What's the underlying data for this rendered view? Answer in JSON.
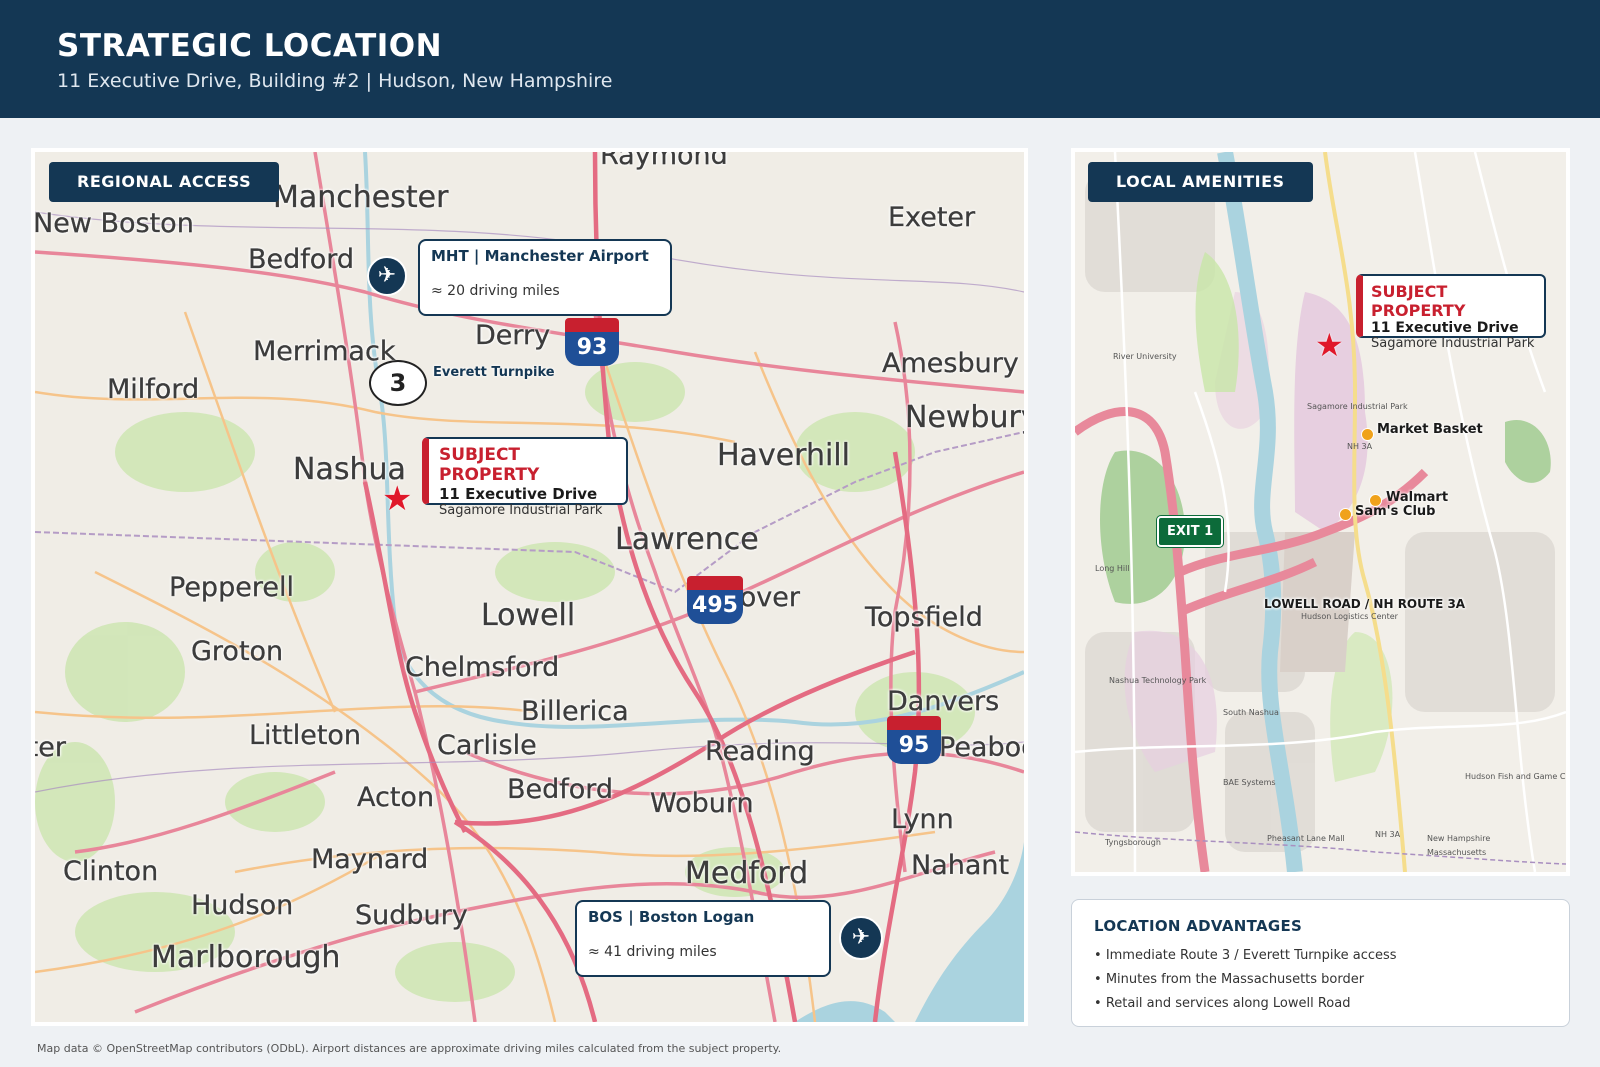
{
  "header": {
    "title": "STRATEGIC LOCATION",
    "subtitle": "11 Executive Drive, Building #2  |  Hudson, New Hampshire"
  },
  "regional_map": {
    "tab_label": "REGIONAL ACCESS",
    "cities": [
      "Raymond",
      "Manchester",
      "New Boston",
      "Bedford",
      "Exeter",
      "Derry",
      "Merrimack",
      "Amesbury",
      "Milford",
      "Newburyport",
      "Nashua",
      "Haverhill",
      "Lawrence",
      "Andover",
      "Pepperell",
      "Lowell",
      "Topsfield",
      "Groton",
      "Chelmsford",
      "Billerica",
      "Littleton",
      "Carlisle",
      "Reading",
      "Danvers",
      "Leominster",
      "Peabody",
      "Acton",
      "Bedford",
      "Woburn",
      "Lynn",
      "Maynard",
      "Clinton",
      "Medford",
      "Nahant",
      "Hudson",
      "Sudbury",
      "Marlborough"
    ],
    "airports": [
      {
        "code": "MHT",
        "name": "Manchester Airport",
        "distance": "≈ 20 driving miles",
        "header": "MHT  |  Manchester Airport"
      },
      {
        "code": "BOS",
        "name": "Boston Logan",
        "distance": "≈ 41 driving miles",
        "header": "BOS  |  Boston Logan"
      }
    ],
    "interstates": [
      "93",
      "495",
      "95"
    ],
    "route3": {
      "number": "3",
      "name": "Everett Turnpike"
    },
    "subject": {
      "line1": "SUBJECT PROPERTY",
      "line2": "11 Executive Drive",
      "line3": "Sagamore Industrial Park"
    }
  },
  "local_map": {
    "tab_label": "LOCAL AMENITIES",
    "subject": {
      "line1": "SUBJECT PROPERTY",
      "line2": "11 Executive Drive",
      "line3": "Sagamore Industrial Park"
    },
    "amenities": [
      "Market Basket",
      "Walmart",
      "Sam's Club"
    ],
    "exit_label": "EXIT 1",
    "road_label": "LOWELL ROAD / NH ROUTE 3A",
    "small_labels": [
      "River University",
      "Sagamore Industrial Park",
      "Hudson Logistics Center",
      "South Nashua",
      "Nashua Technology Park",
      "NH 3A",
      "NH 3A",
      "BAE Systems",
      "Long Hill",
      "Tyngsborough",
      "Pheasant Lane Mall",
      "Hudson Fish and Game Club",
      "New Hampshire",
      "Massachusetts"
    ]
  },
  "advantages": {
    "title": "LOCATION ADVANTAGES",
    "items": [
      "Immediate Route 3 / Everett Turnpike access",
      "Minutes from the Massachusetts border",
      "Retail and services along Lowell Road"
    ]
  },
  "footnote": "Map data © OpenStreetMap contributors (ODbL). Airport distances are approximate driving miles calculated from the subject property.",
  "colors": {
    "navy": "#143754",
    "accent_red": "#c8202f",
    "interstate_blue": "#1f4f97",
    "exit_green": "#0c6b3a",
    "amenity_orange": "#f0a21b"
  },
  "icons": [
    "airplane-icon",
    "star-icon",
    "interstate-shield-icon",
    "route-shield-icon"
  ]
}
